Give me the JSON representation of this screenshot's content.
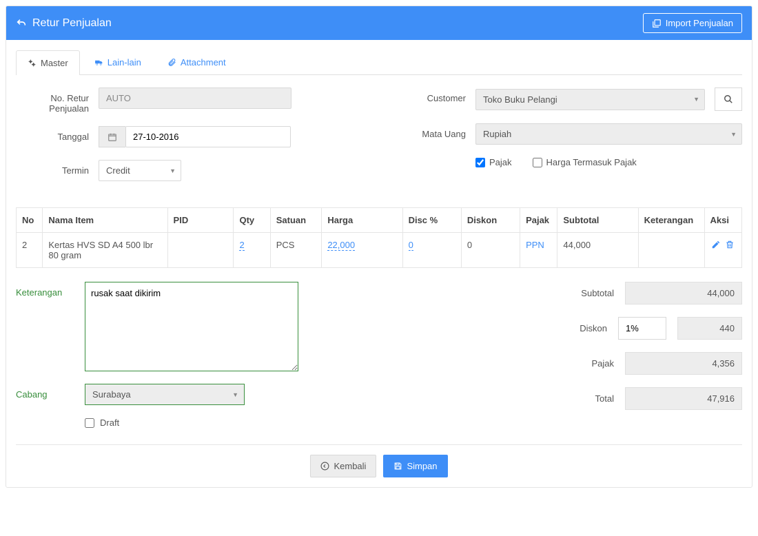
{
  "header": {
    "title": "Retur Penjualan",
    "import_btn": "Import Penjualan"
  },
  "tabs": [
    {
      "label": "Master"
    },
    {
      "label": "Lain-lain"
    },
    {
      "label": "Attachment"
    }
  ],
  "form": {
    "no_retur_label": "No. Retur Penjualan",
    "no_retur_value": "AUTO",
    "tanggal_label": "Tanggal",
    "tanggal_value": "27-10-2016",
    "termin_label": "Termin",
    "termin_value": "Credit",
    "customer_label": "Customer",
    "customer_value": "Toko Buku Pelangi",
    "mata_uang_label": "Mata Uang",
    "mata_uang_value": "Rupiah",
    "pajak_label": "Pajak",
    "harga_termasuk_label": "Harga Termasuk Pajak"
  },
  "table": {
    "headers": [
      "No",
      "Nama Item",
      "PID",
      "Qty",
      "Satuan",
      "Harga",
      "Disc %",
      "Diskon",
      "Pajak",
      "Subtotal",
      "Keterangan",
      "Aksi"
    ],
    "rows": [
      {
        "no": "2",
        "nama": "Kertas HVS SD A4 500 lbr 80 gram",
        "pid": "",
        "qty": "2",
        "satuan": "PCS",
        "harga": "22,000",
        "disc_pct": "0",
        "diskon": "0",
        "pajak": "PPN",
        "subtotal": "44,000",
        "keterangan": ""
      }
    ]
  },
  "bottom": {
    "keterangan_label": "Keterangan",
    "keterangan_value": "rusak saat dikirim",
    "cabang_label": "Cabang",
    "cabang_value": "Surabaya",
    "draft_label": "Draft"
  },
  "totals": {
    "subtotal_label": "Subtotal",
    "subtotal_value": "44,000",
    "diskon_label": "Diskon",
    "diskon_pct": "1%",
    "diskon_value": "440",
    "pajak_label": "Pajak",
    "pajak_value": "4,356",
    "total_label": "Total",
    "total_value": "47,916"
  },
  "footer": {
    "kembali": "Kembali",
    "simpan": "Simpan"
  }
}
